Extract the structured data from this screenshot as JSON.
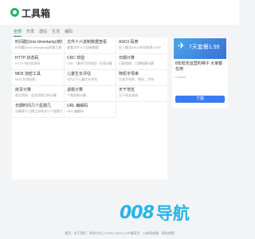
{
  "header": {
    "site_name": "工具箱"
  },
  "tabs": [
    {
      "label": "全部",
      "active": true
    },
    {
      "label": "开发"
    },
    {
      "label": "建站"
    },
    {
      "label": "生活"
    },
    {
      "label": "编码"
    }
  ],
  "tools": [
    {
      "title": "时间戳(Unix timestamp)转换",
      "desc": "时间戳(Unix timestamp)转换工具"
    },
    {
      "title": "文件十六进制数据查看",
      "desc": "查看文件十六进制数据"
    },
    {
      "title": "ASCII 码表",
      "desc": "史上最全ASCII码对照表0-255"
    },
    {
      "title": "HTTP 状态码",
      "desc": "HTTP 响应状态码"
    },
    {
      "title": "CRC 校验",
      "desc": "CRC（循环冗余校验）在线计算"
    },
    {
      "title": "日期计算",
      "desc": "日期相隔、日期推算计算"
    },
    {
      "title": "MD5 加密工具",
      "desc": "MD5 在线加密"
    },
    {
      "title": "儿童生长评估",
      "desc": "0岁以下儿童生长评估"
    },
    {
      "title": "随机字母串",
      "desc": "生成字母串、密码、字串"
    },
    {
      "title": "房贷计算",
      "desc": "商业贷款、组合贷款月供计算"
    },
    {
      "title": "退税计算",
      "desc": "个税退税计算"
    },
    {
      "title": "天干地支",
      "desc": "天干地支查询"
    },
    {
      "title": "日期时间几个星期几",
      "desc": "计算两个日期之间有多少个星期几"
    },
    {
      "title": "URL 编解码",
      "desc": "URL 编解码"
    }
  ],
  "ad": {
    "banner_text": "7天套餐1.99",
    "title": "8年稳定运营的梯子 大家都在用",
    "source": "Letstart",
    "button_label": "下载"
  },
  "promo": {
    "number": "008",
    "text": "导航"
  },
  "footer": {
    "text": "首页 · 关于我们 · 联系方式 | ©2021-2022 | ICP备案号 · 公安网安备 · 网站地图"
  }
}
